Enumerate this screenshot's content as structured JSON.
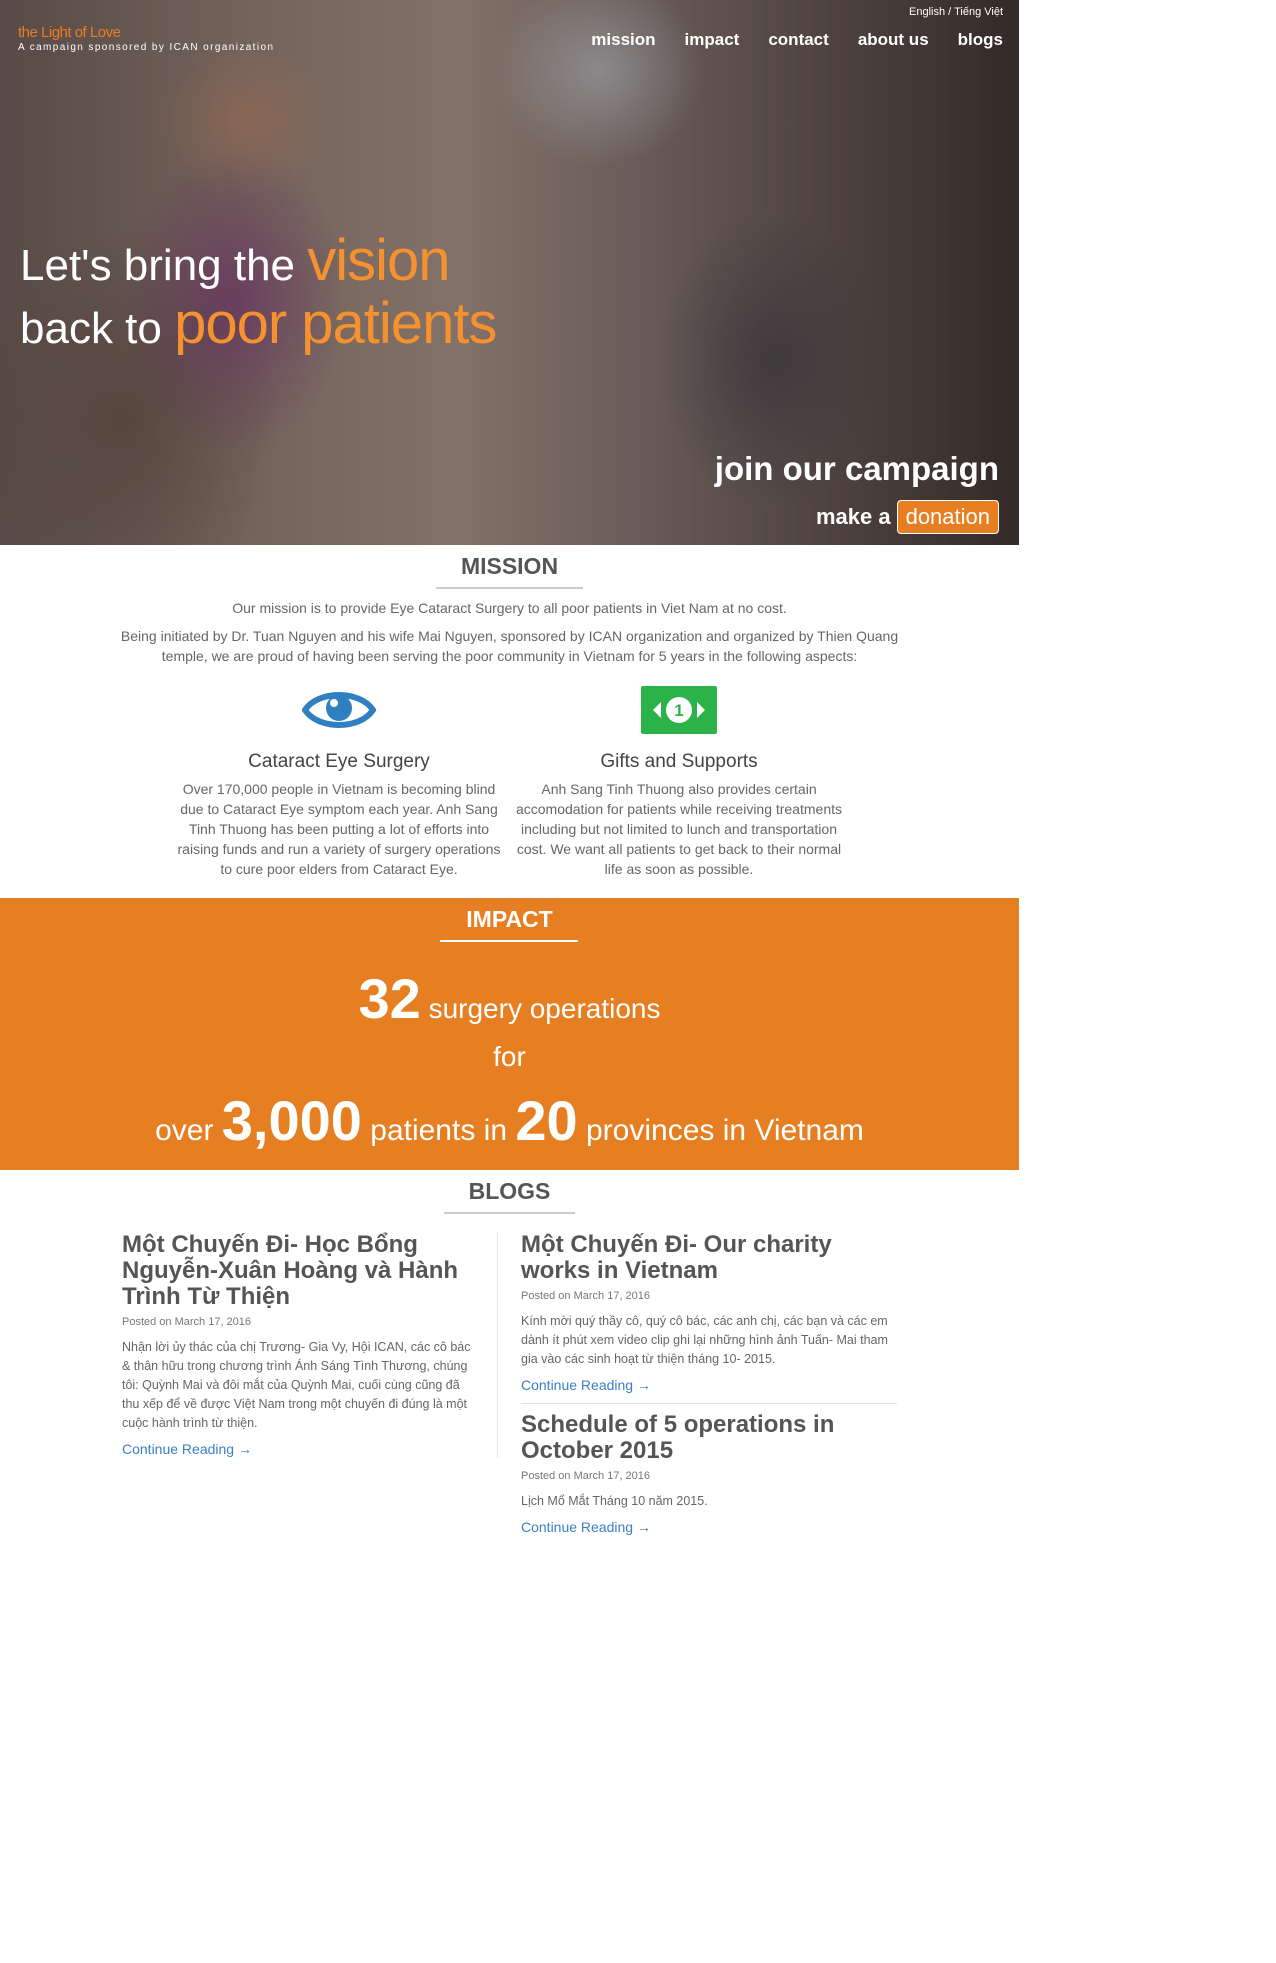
{
  "brand": {
    "title": "the Light of Love",
    "subtitle": "A campaign sponsored by ICAN organization"
  },
  "language": {
    "english": "English",
    "separator": " / ",
    "vietnamese": "Tiếng Việt"
  },
  "nav": {
    "items": [
      "mission",
      "impact",
      "contact",
      "about us",
      "blogs"
    ]
  },
  "hero": {
    "line1_prefix": "Let's bring the ",
    "line1_highlight": "vision",
    "line2_prefix": "back to ",
    "line2_highlight": "poor patients",
    "join": "join our campaign",
    "make": "make a",
    "donation": "donation"
  },
  "mission": {
    "title": "MISSION",
    "text1": "Our mission is to provide Eye Cataract Surgery to all poor patients in Viet Nam at no cost.",
    "text2": "Being initiated by Dr. Tuan Nguyen and his wife Mai Nguyen, sponsored by ICAN organization and organized by Thien Quang temple, we are proud of having been serving the poor community in Vietnam for 5 years in the following aspects:",
    "features": [
      {
        "icon": "eye-icon",
        "title": "Cataract Eye Surgery",
        "text": "Over 170,000 people in Vietnam is becoming blind due to Cataract Eye symptom each year. Anh Sang Tinh Thuong has been putting a lot of efforts into raising funds and run a variety of surgery operations to cure poor elders from Cataract Eye."
      },
      {
        "icon": "money-bill-icon",
        "title": "Gifts and Supports",
        "text": "Anh Sang Tinh Thuong also provides certain accomodation for patients while receiving treatments including but not limited to lunch and transportation cost. We want all patients to get back to their normal life as soon as possible."
      }
    ]
  },
  "impact": {
    "title": "IMPACT",
    "operations_count": "32",
    "operations_label": " surgery operations",
    "for": "for",
    "over": "over ",
    "patients_count": "3,000",
    "patients_label": " patients in ",
    "provinces_count": "20",
    "provinces_label": " provinces in Vietnam"
  },
  "blogs": {
    "title": "BLOGS",
    "posts": [
      {
        "title": "Một Chuyến Đi- Học Bổng Nguyễn-Xuân Hoàng và Hành Trình Từ Thiện",
        "date": "Posted on March 17, 2016",
        "excerpt": "Nhận lời ủy thác của chị Trương- Gia Vy, Hội ICAN, các cô bác & thân hữu trong chương trình Ánh Sáng Tình Thương, chúng tôi: Quỳnh Mai và đôi mắt của Quỳnh Mai, cuối cùng cũng đã thu xếp để về được Việt Nam trong một chuyến đi đúng là một cuộc hành trình từ thiện.",
        "link": "Continue Reading →"
      },
      {
        "title": "Một Chuyến Đi- Our charity works in Vietnam",
        "date": "Posted on March 17, 2016",
        "excerpt": "Kính mời quý thầy cô, quý cô bác, các anh chị, các bạn và các em dành ít phút xem video clip ghi lại những hình ảnh Tuấn- Mai tham gia vào các sinh hoạt từ thiện tháng 10- 2015.",
        "link": "Continue Reading →"
      },
      {
        "title": "Schedule of 5 operations in October 2015",
        "date": "Posted on March 17, 2016",
        "excerpt": "Lịch Mổ Mắt Tháng 10 năm 2015.",
        "link": "Continue Reading →"
      }
    ]
  },
  "colors": {
    "accent": "#e67e22",
    "eye_icon": "#2f7fc1",
    "money_icon": "#2bb34a",
    "link": "#3a7fc4"
  }
}
